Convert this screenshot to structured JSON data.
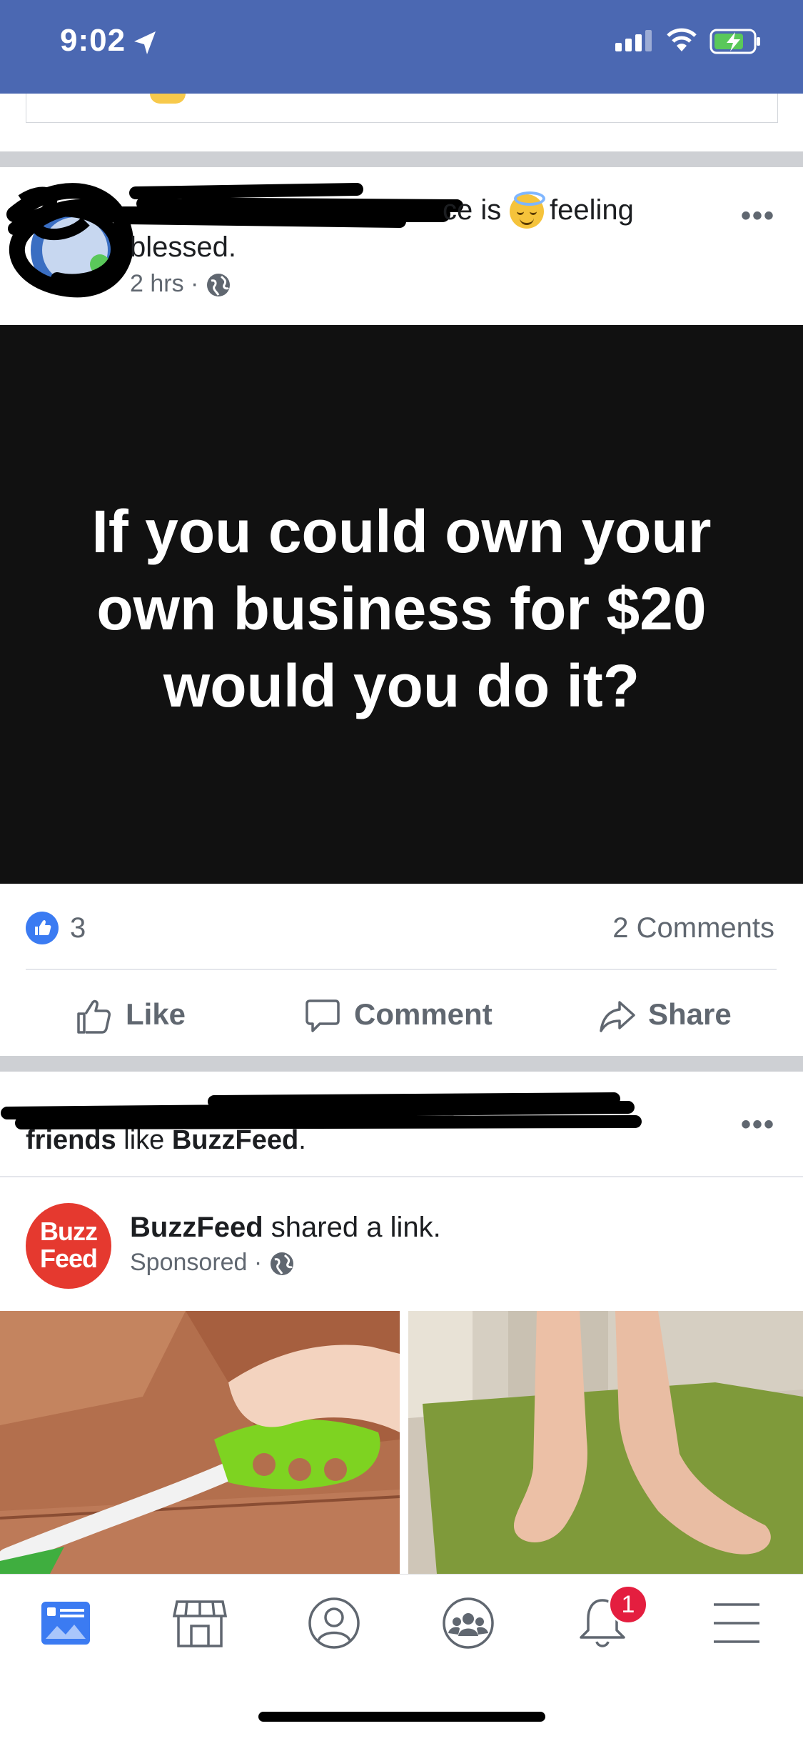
{
  "status_bar": {
    "time": "9:02"
  },
  "post1": {
    "author_visible_fragment": "ce is",
    "feeling": "feeling",
    "feeling_value": "blessed.",
    "time": "2 hrs",
    "more": "•••",
    "image_text": "If you could own your own business for $20 would you do it?",
    "likes": "3",
    "comments": "2 Comments",
    "actions": {
      "like": "Like",
      "comment": "Comment",
      "share": "Share"
    }
  },
  "post2": {
    "friends_line_bold": "friends",
    "friends_line_mid": " like ",
    "friends_line_page": "BuzzFeed",
    "friends_line_end": ".",
    "more": "•••",
    "page_name": "BuzzFeed",
    "shared": " shared a link.",
    "sponsored": "Sponsored",
    "logo_top": "Buzz",
    "logo_bottom": "Feed"
  },
  "tab_bar": {
    "notifications_badge": "1",
    "tabs": [
      "news-feed",
      "marketplace",
      "profile",
      "groups",
      "notifications",
      "menu"
    ]
  },
  "colors": {
    "brand": "#4b68b2",
    "like_blue": "#3b7bf2",
    "buzzfeed_red": "#e5392f",
    "badge_red": "#e41e3f"
  }
}
